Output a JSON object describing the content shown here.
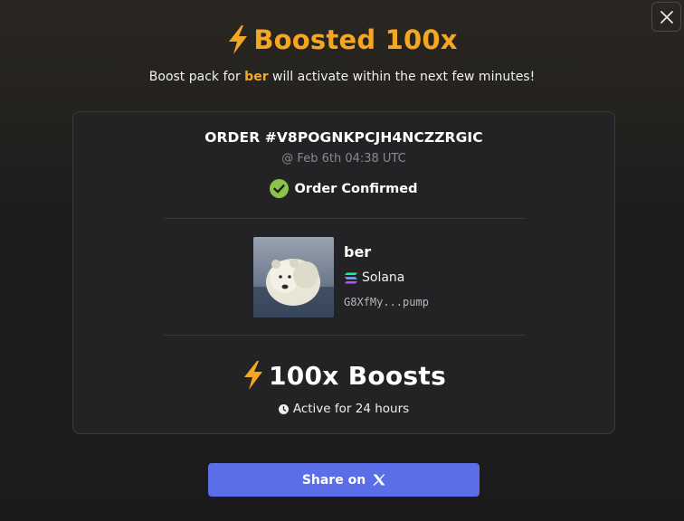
{
  "modal": {
    "title": "Boosted 100x",
    "subtitle_prefix": "Boost pack for ",
    "subtitle_token": "ber",
    "subtitle_suffix": " will activate within the next few minutes!",
    "close_icon": "close-icon"
  },
  "order": {
    "id": "ORDER #V8POGNKPCJH4NCZZRGIC",
    "time": "@ Feb 6th 04:38 UTC",
    "status": "Order Confirmed",
    "status_color": "#8bc34a"
  },
  "token": {
    "name": "ber",
    "chain": "Solana",
    "address": "G8XfMy...pump",
    "image": "polar-bear-avatar"
  },
  "boost": {
    "label": "100x Boosts",
    "duration": "Active for 24 hours",
    "icon": "lightning-icon",
    "accent": "#f5a623"
  },
  "share": {
    "label": "Share on",
    "icon": "x-logo-icon",
    "color": "#5b6ee8"
  }
}
